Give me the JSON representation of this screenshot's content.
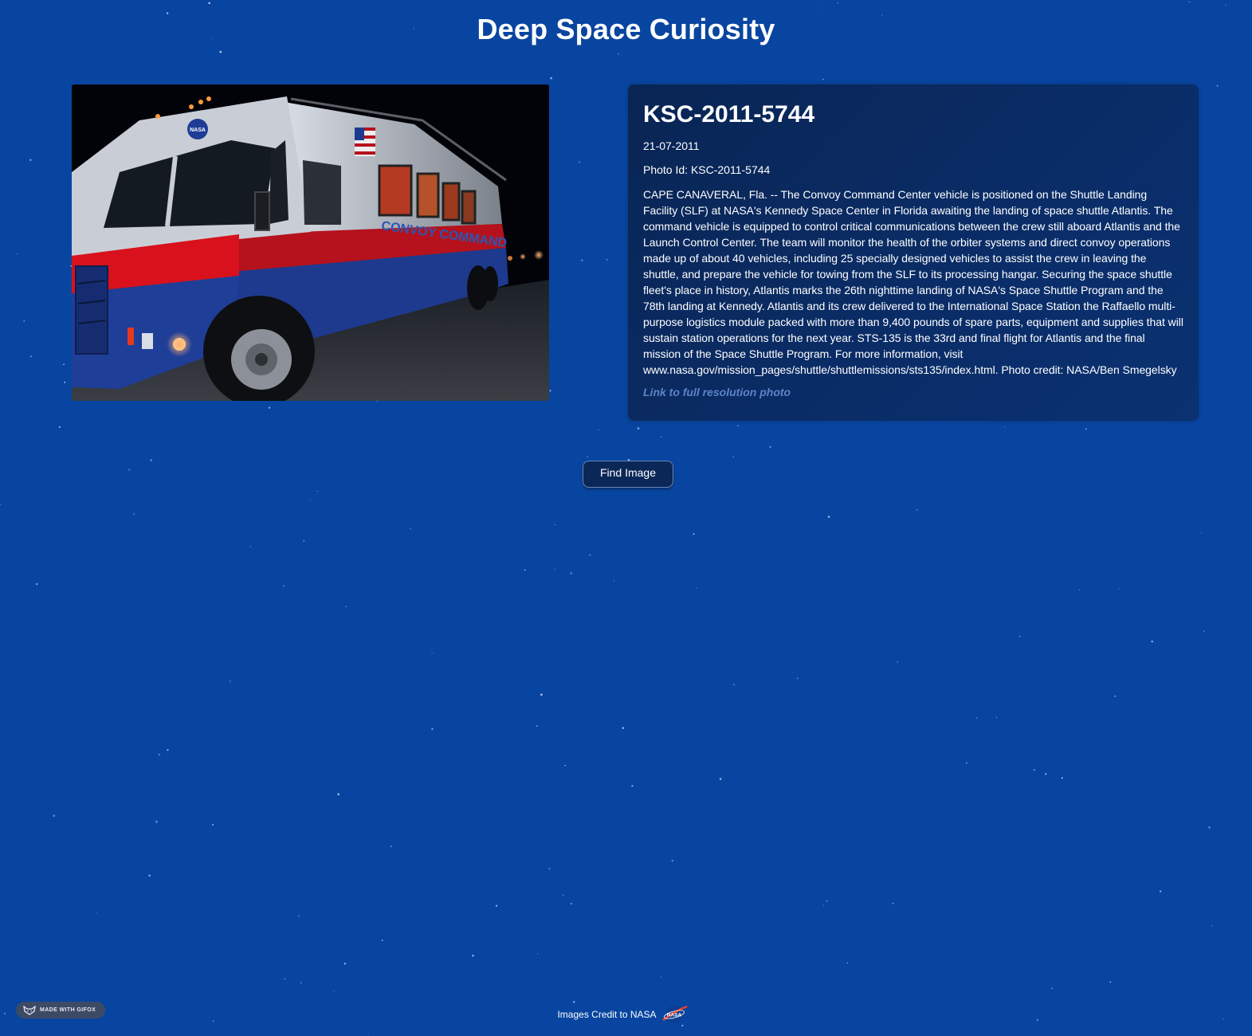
{
  "header": {
    "title": "Deep Space Curiosity"
  },
  "photo": {
    "title": "KSC-2011-5744",
    "date": "21-07-2011",
    "id_label": "Photo Id:",
    "id_value": "KSC-2011-5744",
    "description": "CAPE CANAVERAL, Fla. -- The Convoy Command Center vehicle is positioned on the Shuttle Landing Facility (SLF) at NASA's Kennedy Space Center in Florida awaiting the landing of space shuttle Atlantis. The command vehicle is equipped to control critical communications between the crew still aboard Atlantis and the Launch Control Center. The team will monitor the health of the orbiter systems and direct convoy operations made up of about 40 vehicles, including 25 specially designed vehicles to assist the crew in leaving the shuttle, and prepare the vehicle for towing from the SLF to its processing hangar. Securing the space shuttle fleet's place in history, Atlantis marks the 26th nighttime landing of NASA's Space Shuttle Program and the 78th landing at Kennedy. Atlantis and its crew delivered to the International Space Station the Raffaello multi-purpose logistics module packed with more than 9,400 pounds of spare parts, equipment and supplies that will sustain station operations for the next year. STS-135 is the 33rd and final flight for Atlantis and the final mission of the Space Shuttle Program. For more information, visit www.nasa.gov/mission_pages/shuttle/shuttlemissions/sts135/index.html. Photo credit: NASA/Ben Smegelsky",
    "link_label": "Link to full resolution photo",
    "image_text": {
      "truck_lettering": "CONVOY COMMAND",
      "badge": "NASA"
    }
  },
  "actions": {
    "find_image_label": "Find Image"
  },
  "badge": {
    "label": "MADE WITH GIFOX"
  },
  "footer": {
    "credit": "Images Credit to NASA",
    "logo_text": "NASA",
    "logo_icon": "nasa-logo-icon"
  },
  "colors": {
    "background": "#0845a0",
    "card": "#0a2a5f",
    "link": "#5d84c7",
    "button": "#0b2757"
  }
}
